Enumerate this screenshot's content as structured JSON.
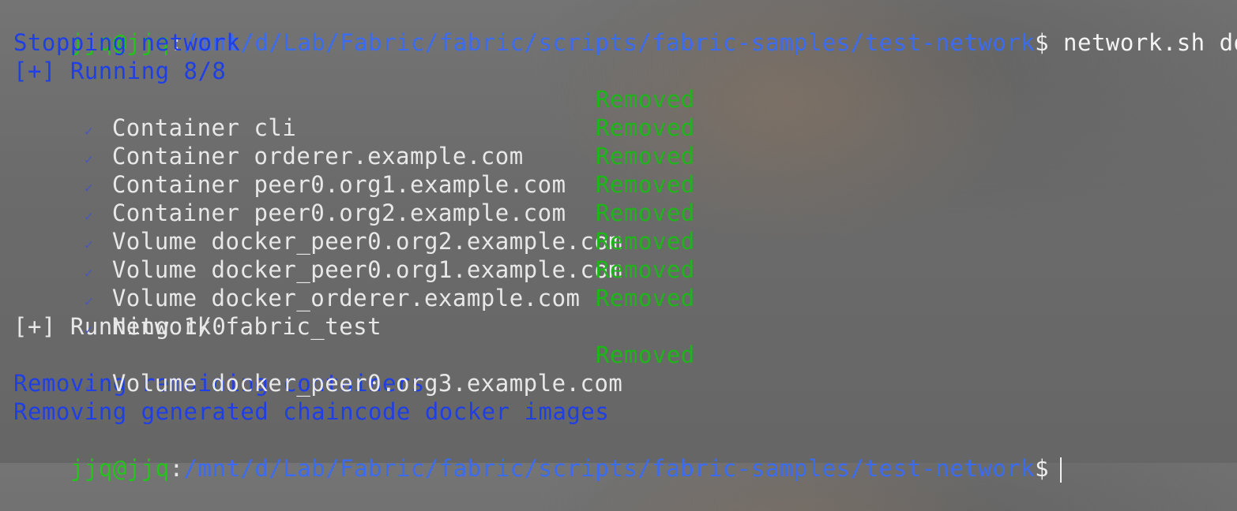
{
  "prompt": {
    "user_host": "jjq@jjq",
    "colon": ":",
    "path": "/mnt/d/Lab/Fabric/fabric/scripts/fabric-samples/test-network",
    "dollar": "$"
  },
  "command": " network.sh down",
  "messages": {
    "stopping": "Stopping network",
    "running_1": "[+] Running 8/8",
    "running_2": "[+] Running 1/0",
    "removing_containers": "Removing remaining containers",
    "removing_images": "Removing generated chaincode docker images"
  },
  "check_glyph": "✓",
  "group1": [
    {
      "label": "Container cli",
      "status": "Removed"
    },
    {
      "label": "Container orderer.example.com",
      "status": "Removed"
    },
    {
      "label": "Container peer0.org1.example.com",
      "status": "Removed"
    },
    {
      "label": "Container peer0.org2.example.com",
      "status": "Removed"
    },
    {
      "label": "Volume docker_peer0.org2.example.com",
      "status": "Removed"
    },
    {
      "label": "Volume docker_peer0.org1.example.com",
      "status": "Removed"
    },
    {
      "label": "Volume docker_orderer.example.com",
      "status": "Removed"
    },
    {
      "label": "Network fabric_test",
      "status": "Removed"
    }
  ],
  "group2": [
    {
      "label": "Volume docker_peer0.org3.example.com",
      "status": "Removed"
    }
  ],
  "colors": {
    "prompt_user": "#22c51a",
    "prompt_path": "#3b6cf0",
    "info_blue": "#1f3fe6",
    "status_green": "#1fb51a"
  }
}
